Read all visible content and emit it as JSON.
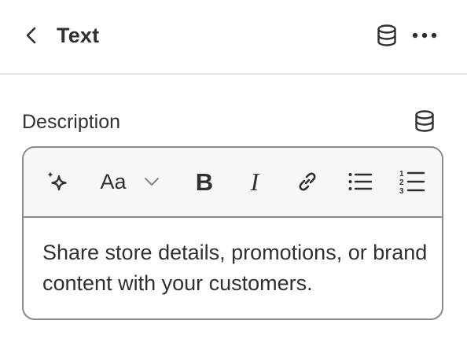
{
  "header": {
    "title": "Text",
    "back_icon": "chevron-left-icon",
    "source_icon": "database-icon",
    "more_icon": "more-horizontal-icon"
  },
  "field": {
    "label": "Description",
    "source_icon": "database-icon"
  },
  "toolbar": {
    "ai_icon": "sparkle-icon",
    "font_label": "Aa",
    "font_dropdown_icon": "chevron-down-icon",
    "bold_label": "B",
    "italic_label": "I",
    "link_icon": "link-icon",
    "bullet_list_icon": "bullet-list-icon",
    "numbered_list_icon": "numbered-list-icon"
  },
  "editor": {
    "content": "Share store details, promotions, or brand content with your customers."
  },
  "colors": {
    "text": "#303030",
    "divider": "#e6e6e6",
    "border": "#8a8a8a",
    "toolbar_bg": "#f7f7f7"
  }
}
